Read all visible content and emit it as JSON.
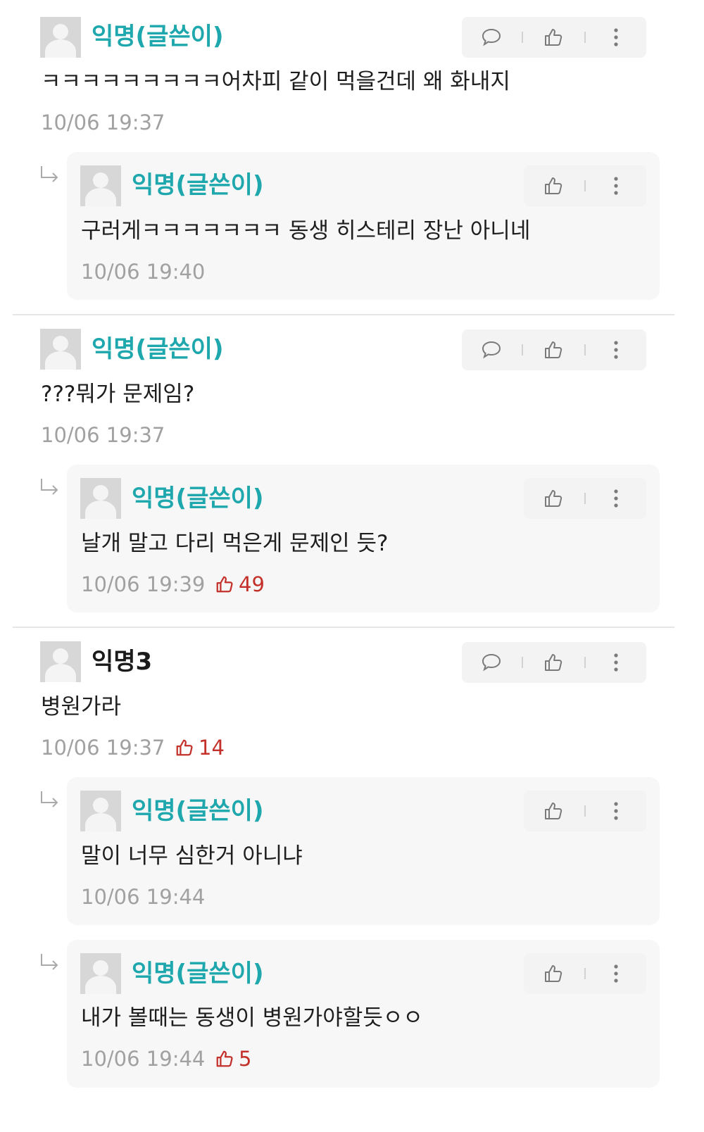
{
  "comments": [
    {
      "author": "익명(글쓴이)",
      "text": "ㅋㅋㅋㅋㅋㅋㅋㅋㅋ어차피 같이 먹을건데 왜 화내지",
      "time": "10/06 19:37",
      "replies": [
        {
          "author": "익명(글쓴이)",
          "text": "구러게ㅋㅋㅋㅋㅋㅋㅋ 동생 히스테리 장난 아니네",
          "time": "10/06 19:40"
        }
      ]
    },
    {
      "author": "익명(글쓴이)",
      "text": "???뭐가 문제임?",
      "time": "10/06 19:37",
      "replies": [
        {
          "author": "익명(글쓴이)",
          "text": "날개 말고 다리 먹은게 문제인 듯?",
          "time": "10/06 19:39",
          "likes": "49"
        }
      ]
    },
    {
      "author": "익명3",
      "text": "병원가라",
      "time": "10/06 19:37",
      "likes": "14",
      "replies": [
        {
          "author": "익명(글쓴이)",
          "text": "말이 너무 심한거 아니냐",
          "time": "10/06 19:44"
        },
        {
          "author": "익명(글쓴이)",
          "text": "내가 볼때는 동생이 병원가야할듯ㅇㅇ",
          "time": "10/06 19:44",
          "likes": "5"
        }
      ]
    }
  ],
  "icons": {
    "reply": "speech-bubble-icon",
    "like": "thumbs-up-icon",
    "more": "more-vertical-icon",
    "reply_indent": "reply-arrow-icon"
  },
  "colors": {
    "author_op": "#1ea7ad",
    "likes": "#c4312a",
    "meta": "#a1a1a1"
  }
}
